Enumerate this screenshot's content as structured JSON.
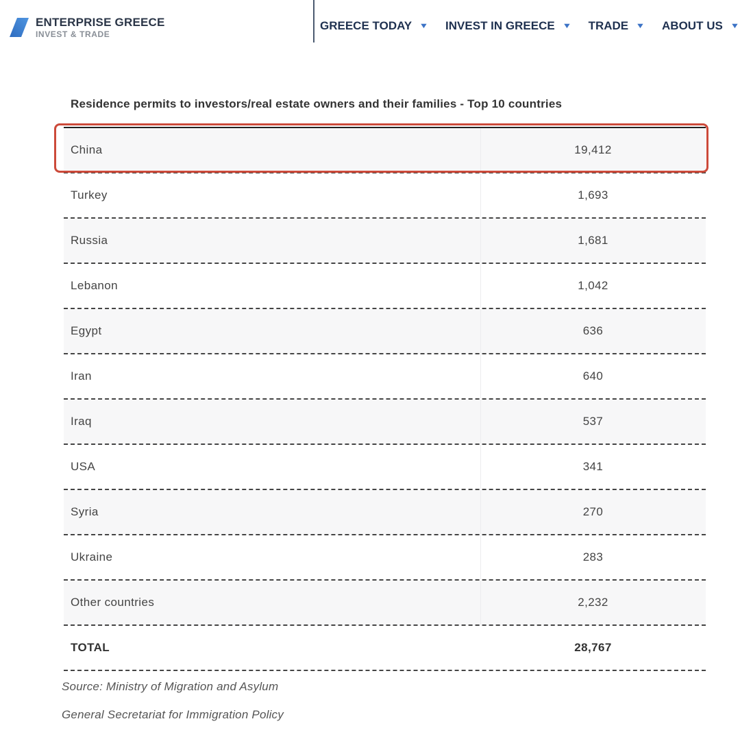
{
  "header": {
    "logo": {
      "icon": "enterprise-greece-slash-logo",
      "title": "ENTERPRISE GREECE",
      "subtitle": "INVEST & TRADE"
    },
    "nav": [
      {
        "label": "GREECE TODAY",
        "icon": "chevron-down"
      },
      {
        "label": "INVEST IN GREECE",
        "icon": "chevron-down"
      },
      {
        "label": "TRADE",
        "icon": "chevron-down"
      },
      {
        "label": "ABOUT US",
        "icon": "chevron-down"
      }
    ]
  },
  "table": {
    "title": "Residence permits to investors/real estate owners and their families - Top 10 countries",
    "highlighted_row": "China",
    "highlight_color": "#cc4a3a",
    "rows": [
      {
        "country": "China",
        "value": "19,412"
      },
      {
        "country": "Turkey",
        "value": "1,693"
      },
      {
        "country": "Russia",
        "value": "1,681"
      },
      {
        "country": "Lebanon",
        "value": "1,042"
      },
      {
        "country": "Egypt",
        "value": "636"
      },
      {
        "country": "Iran",
        "value": "640"
      },
      {
        "country": "Iraq",
        "value": "537"
      },
      {
        "country": "USA",
        "value": "341"
      },
      {
        "country": "Syria",
        "value": "270"
      },
      {
        "country": "Ukraine",
        "value": "283"
      },
      {
        "country": "Other countries",
        "value": "2,232"
      }
    ],
    "total": {
      "label": "TOTAL",
      "value": "28,767"
    }
  },
  "source": {
    "line1": "Source: Ministry of Migration and Asylum",
    "line2": "General Secretariat for Immigration Policy"
  }
}
